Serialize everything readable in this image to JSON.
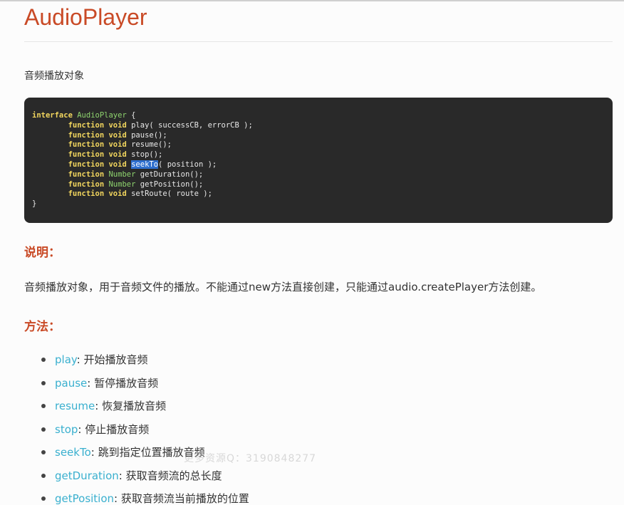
{
  "page": {
    "title": "AudioPlayer",
    "intro": "音频播放对象"
  },
  "code": {
    "lines": [
      [
        {
          "t": "interface",
          "c": "kw"
        },
        {
          "t": " "
        },
        {
          "t": "AudioPlayer",
          "c": "ty"
        },
        {
          "t": " {"
        }
      ],
      [
        {
          "t": "        "
        },
        {
          "t": "function",
          "c": "kw"
        },
        {
          "t": " "
        },
        {
          "t": "void",
          "c": "kw"
        },
        {
          "t": " play( successCB, errorCB );"
        }
      ],
      [
        {
          "t": "        "
        },
        {
          "t": "function",
          "c": "kw"
        },
        {
          "t": " "
        },
        {
          "t": "void",
          "c": "kw"
        },
        {
          "t": " pause();"
        }
      ],
      [
        {
          "t": "        "
        },
        {
          "t": "function",
          "c": "kw"
        },
        {
          "t": " "
        },
        {
          "t": "void",
          "c": "kw"
        },
        {
          "t": " resume();"
        }
      ],
      [
        {
          "t": "        "
        },
        {
          "t": "function",
          "c": "kw"
        },
        {
          "t": " "
        },
        {
          "t": "void",
          "c": "kw"
        },
        {
          "t": " stop();"
        }
      ],
      [
        {
          "t": "        "
        },
        {
          "t": "function",
          "c": "kw"
        },
        {
          "t": " "
        },
        {
          "t": "void",
          "c": "kw"
        },
        {
          "t": " "
        },
        {
          "t": "seekTo",
          "c": "sel"
        },
        {
          "t": "( position );"
        }
      ],
      [
        {
          "t": "        "
        },
        {
          "t": "function",
          "c": "kw"
        },
        {
          "t": " "
        },
        {
          "t": "Number",
          "c": "ty"
        },
        {
          "t": " getDuration();"
        }
      ],
      [
        {
          "t": "        "
        },
        {
          "t": "function",
          "c": "kw"
        },
        {
          "t": " "
        },
        {
          "t": "Number",
          "c": "ty"
        },
        {
          "t": " getPosition();"
        }
      ],
      [
        {
          "t": "        "
        },
        {
          "t": "function",
          "c": "kw"
        },
        {
          "t": " "
        },
        {
          "t": "void",
          "c": "kw"
        },
        {
          "t": " setRoute( route );"
        }
      ],
      [
        {
          "t": "}"
        }
      ]
    ]
  },
  "description": {
    "heading": "说明：",
    "text": "音频播放对象，用于音频文件的播放。不能通过new方法直接创建，只能通过audio.createPlayer方法创建。"
  },
  "methods": {
    "heading": "方法：",
    "items": [
      {
        "name": "play",
        "sep": ": ",
        "desc": "开始播放音频"
      },
      {
        "name": "pause",
        "sep": ": ",
        "desc": "暂停播放音频"
      },
      {
        "name": "resume",
        "sep": ": ",
        "desc": "恢复播放音频"
      },
      {
        "name": "stop",
        "sep": ": ",
        "desc": "停止播放音频"
      },
      {
        "name": "seekTo",
        "sep": ": ",
        "desc": "跳到指定位置播放音频"
      },
      {
        "name": "getDuration",
        "sep": ": ",
        "desc": "获取音频流的总长度"
      },
      {
        "name": "getPosition",
        "sep": ": ",
        "desc": "获取音频流当前播放的位置"
      }
    ]
  },
  "watermark": "更多资源Q：3190848277",
  "colors": {
    "heading": "#c94a26",
    "link": "#3ab0cf",
    "code_bg": "#292929",
    "keyword": "#f2d65e",
    "type": "#8ed36e",
    "selection": "#2f6fce"
  }
}
